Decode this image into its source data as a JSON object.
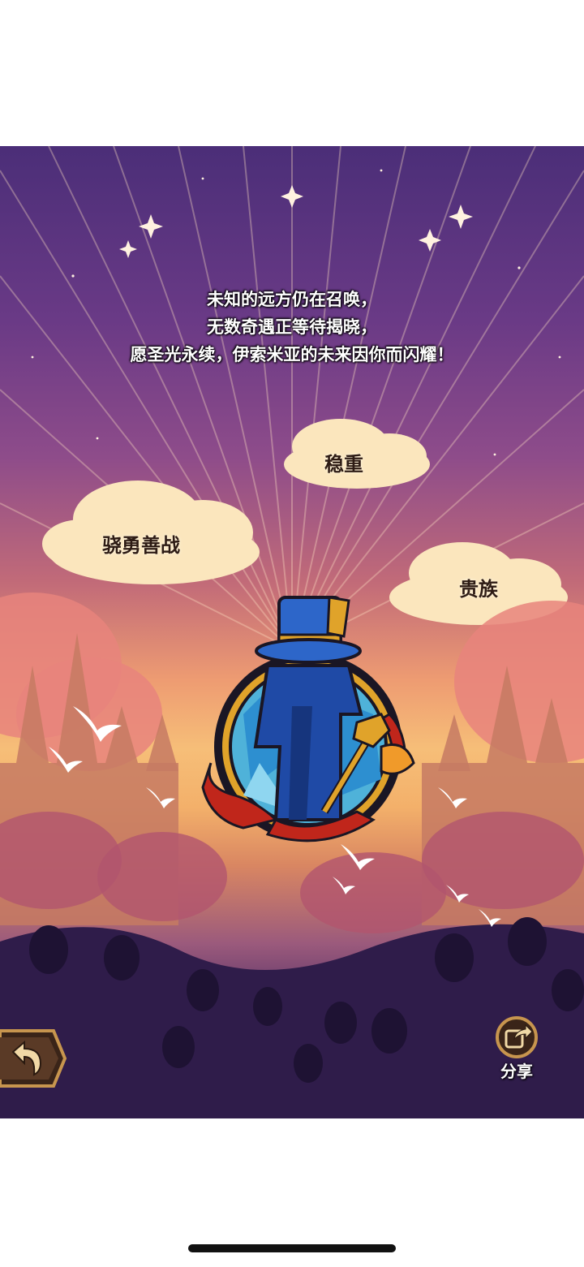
{
  "poem": {
    "line1": "未知的远方仍在召唤，",
    "line2": "无数奇遇正等待揭晓，",
    "line3": "愿圣光永续，伊索米亚的未来因你而闪耀！"
  },
  "traits": {
    "brave": "骁勇善战",
    "steady": "稳重",
    "noble": "贵族"
  },
  "controls": {
    "share_label": "分享"
  },
  "icons": {
    "back": "back-arrow-icon",
    "share": "share-icon",
    "emblem": "stained-glass-emblem"
  },
  "colors": {
    "sky_top": "#4b2e78",
    "sky_glow": "#f6be78",
    "ground": "#2b1a47",
    "cloud": "#fbe6bd",
    "emblem_blue": "#1f4aa6",
    "emblem_gold": "#e0a32a",
    "ribbon_red": "#c0261b"
  }
}
